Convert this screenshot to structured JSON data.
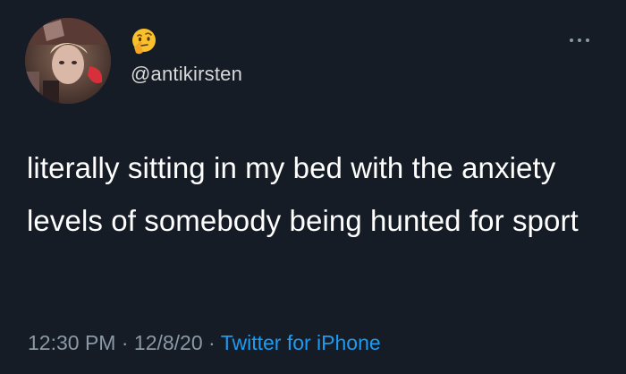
{
  "tweet": {
    "author_handle": "@antikirsten",
    "avatar_icon": "profile-photo-avatar",
    "status_emoji": "thinking-face-emoji",
    "more_icon": "ellipsis-icon",
    "text": "literally sitting in my bed with the anxiety levels of somebody being hunted for sport",
    "time": "12:30 PM",
    "separator_1": "·",
    "date": "12/8/20",
    "separator_2": "·",
    "source": "Twitter for iPhone"
  },
  "colors": {
    "background": "#151c26",
    "text": "#ffffff",
    "secondary_text": "#8b98a5",
    "link": "#1d9bf0"
  }
}
